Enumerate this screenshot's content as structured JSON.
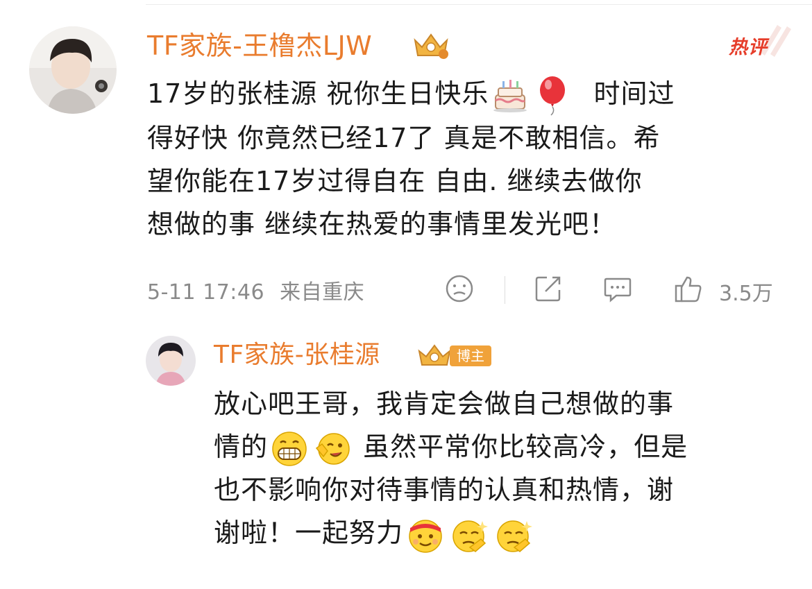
{
  "comment": {
    "username": "TF家族-王橹杰LJW",
    "hot_label": "热评",
    "text_lines": [
      "17岁的张桂源 祝你生日快乐",
      "时间过",
      "得好快 你竟然已经17了 真是不敢相信。希",
      "望你能在17岁过得自在  自由. 继续去做你",
      "想做的事  继续在热爱的事情里发光吧！"
    ],
    "emojis": [
      "cake-emoji",
      "balloon-emoji"
    ],
    "timestamp": "5-11 17:46",
    "location": "来自重庆",
    "like_count": "3.5万"
  },
  "reply": {
    "username": "TF家族-张桂源",
    "role_badge": "博主",
    "text_lines": [
      "放心吧王哥，我肯定会做自己想做的事",
      "情的",
      "虽然平常你比较高冷，但是",
      "也不影响你对待事情的认真和热情，谢",
      "谢啦！一起努力"
    ],
    "emojis": [
      "grin-emoji",
      "wink-emoji",
      "fighting-emoji",
      "smug-emoji",
      "smug-emoji"
    ]
  },
  "colors": {
    "username": "#e97c2e",
    "hot": "#e63d2a",
    "meta": "#8a8a8a",
    "badge": "#f0a23a"
  }
}
